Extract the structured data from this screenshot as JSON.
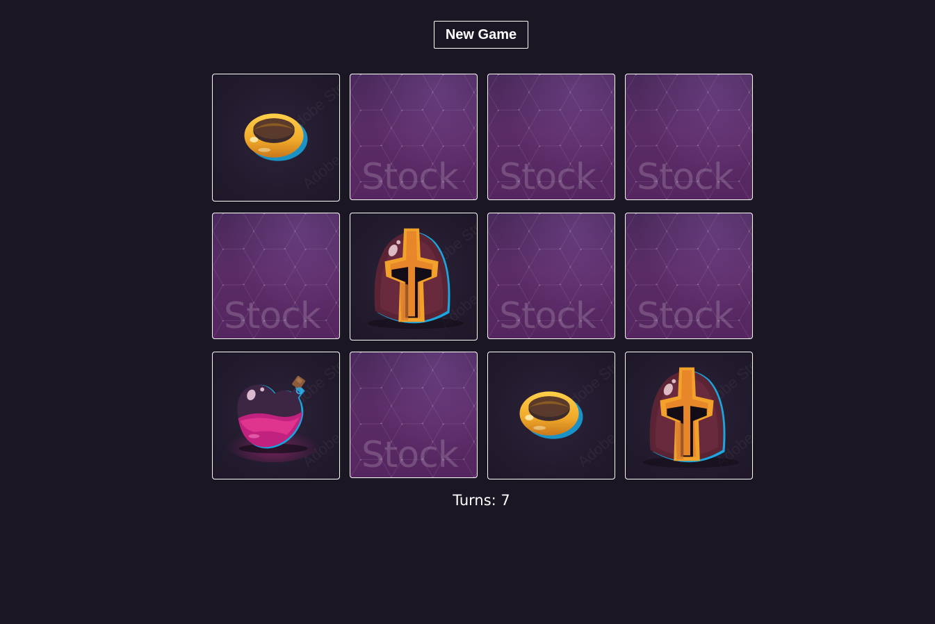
{
  "header": {
    "new_game_label": "New Game"
  },
  "board": {
    "back_text": "Stock",
    "watermark_text": "Adobe Stock",
    "cards": [
      {
        "state": "front",
        "icon": "ring-icon"
      },
      {
        "state": "back"
      },
      {
        "state": "back"
      },
      {
        "state": "back"
      },
      {
        "state": "back"
      },
      {
        "state": "front",
        "icon": "helmet-icon"
      },
      {
        "state": "back"
      },
      {
        "state": "back"
      },
      {
        "state": "front",
        "icon": "potion-icon"
      },
      {
        "state": "back"
      },
      {
        "state": "front",
        "icon": "ring-icon"
      },
      {
        "state": "front",
        "icon": "helmet-icon"
      }
    ]
  },
  "status": {
    "turns_label": "Turns:",
    "turns_value": "7"
  },
  "colors": {
    "background": "#1b1623",
    "card_back": "#55285f",
    "card_border": "#ffffff",
    "text": "#ffffff",
    "ring_gold": "#f2b632",
    "potion_pink": "#d2288c"
  }
}
